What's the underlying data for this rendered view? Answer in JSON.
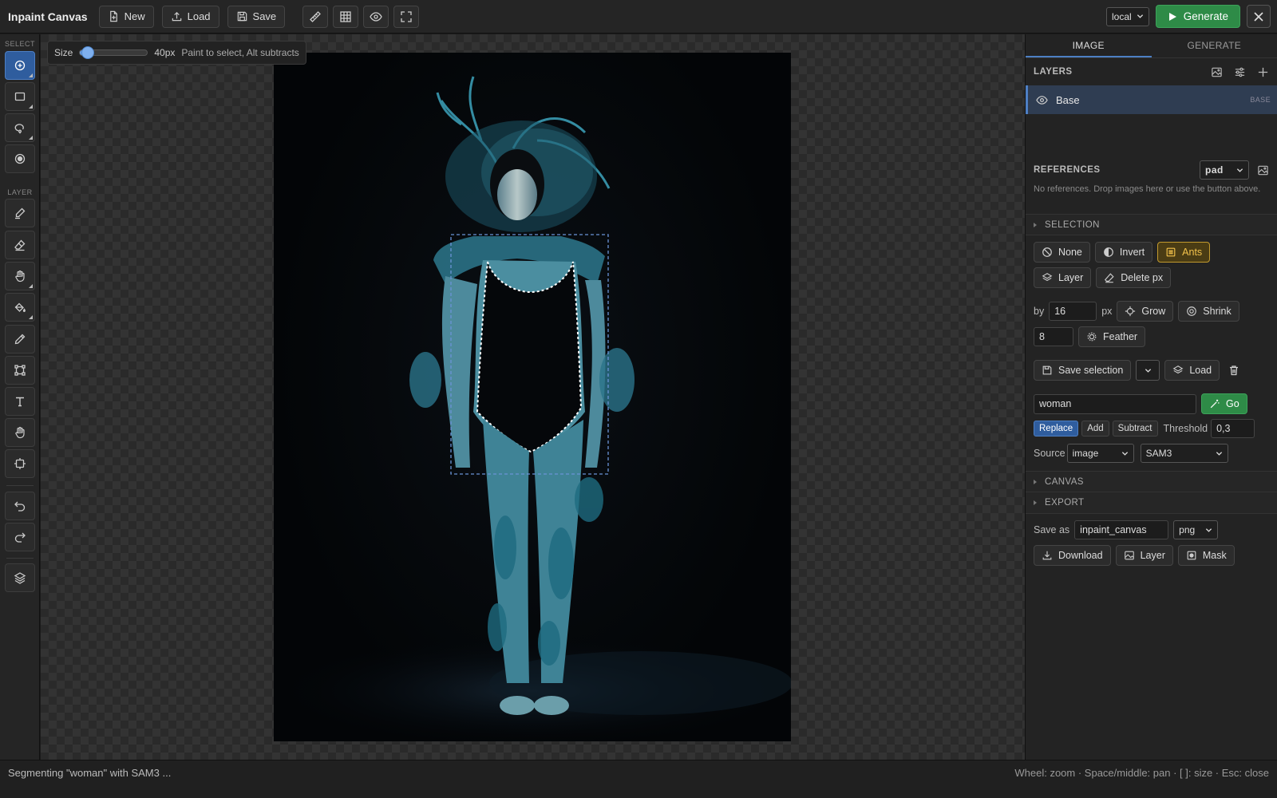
{
  "header": {
    "title": "Inpaint Canvas",
    "new_label": "New",
    "load_label": "Load",
    "save_label": "Save",
    "backend_select": "local",
    "generate_label": "Generate"
  },
  "leftbar": {
    "select_section": "SELECT",
    "layer_section": "LAYER"
  },
  "canvas": {
    "size_label": "Size",
    "size_value": "40px",
    "size_fraction": 0.12,
    "size_hint": "Paint to select, Alt subtracts"
  },
  "panel": {
    "tabs": [
      "IMAGE",
      "GENERATE"
    ],
    "layers": {
      "title": "LAYERS",
      "items": [
        {
          "name": "Base",
          "badge": "BASE"
        }
      ]
    },
    "references": {
      "title": "REFERENCES",
      "mode": "pad",
      "note": "No references. Drop images here or use the button above."
    },
    "selection": {
      "title": "SELECTION",
      "none_label": "None",
      "invert_label": "Invert",
      "ants_label": "Ants",
      "layer_label": "Layer",
      "delete_label": "Delete px",
      "by_label": "by",
      "grow_amount": "16",
      "px_label": "px",
      "grow_label": "Grow",
      "shrink_label": "Shrink",
      "feather_amount": "8",
      "feather_label": "Feather",
      "save_selection_label": "Save selection",
      "load_label": "Load",
      "prompt_value": "woman",
      "go_label": "Go",
      "mode_replace": "Replace",
      "mode_add": "Add",
      "mode_subtract": "Subtract",
      "threshold_label": "Threshold",
      "threshold_value": "0,3",
      "source_label": "Source",
      "source_value": "image",
      "model_value": "SAM3"
    },
    "canvas_section": "CANVAS",
    "export": {
      "title": "EXPORT",
      "save_as_label": "Save as",
      "filename": "inpaint_canvas",
      "format": "png",
      "download_label": "Download",
      "layer_label": "Layer",
      "mask_label": "Mask"
    }
  },
  "status": {
    "message": "Segmenting \"woman\" with SAM3 ...",
    "shortcuts": "Wheel: zoom · Space/middle: pan · [ ]: size · Esc: close"
  }
}
